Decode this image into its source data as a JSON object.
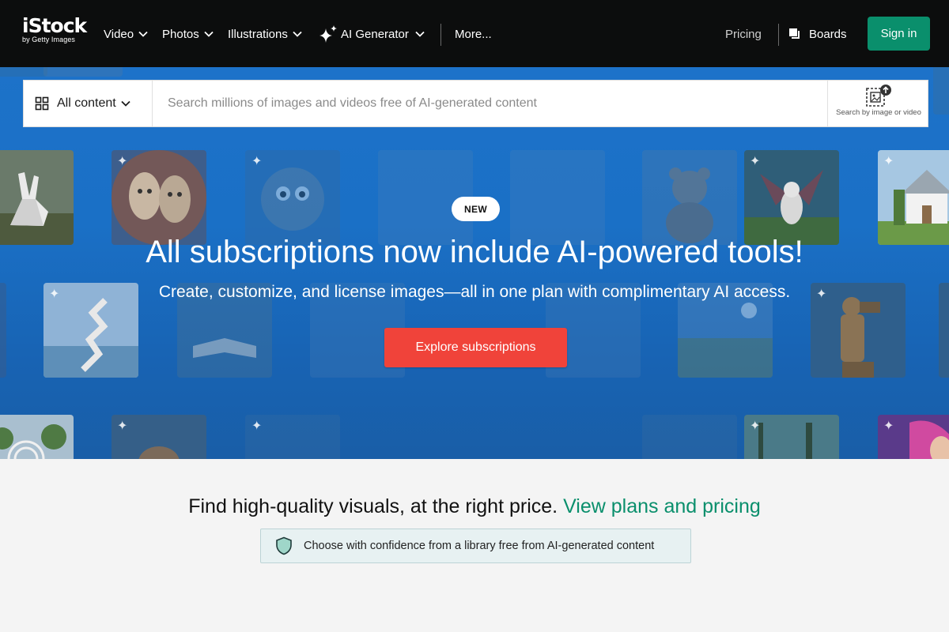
{
  "nav": {
    "logo_main": "iStock",
    "logo_sub": "by Getty Images",
    "items": [
      {
        "label": "Video",
        "icon": "chevron-down-icon"
      },
      {
        "label": "Photos",
        "icon": "chevron-down-icon"
      },
      {
        "label": "Illustrations",
        "icon": "chevron-down-icon"
      },
      {
        "label": "AI Generator",
        "icon": "sparkle-icon"
      },
      {
        "label": "More..."
      }
    ],
    "pricing": "Pricing",
    "boards": "Boards",
    "signin": "Sign in"
  },
  "search": {
    "scope": "All content",
    "placeholder": "Search millions of images and videos free of AI-generated content",
    "by_image_label": "Search by image or video"
  },
  "hero": {
    "badge": "NEW",
    "title": "All subscriptions now include AI-powered tools!",
    "subtitle": "Create, customize, and license images—all in one plan with complimentary AI access.",
    "cta": "Explore subscriptions",
    "tiles": [
      "rabbit",
      "masks",
      "fluffy-creature",
      "teddy-bear",
      "winged-cat",
      "house",
      "staircase",
      "open-book",
      "landscape",
      "photographer-statue",
      "forest-circle",
      "squirrel",
      "trees",
      "woman-portrait"
    ]
  },
  "lower": {
    "heading": "Find high-quality visuals, at the right price.",
    "link": "View plans and pricing",
    "confidence": "Choose with confidence from a library free from AI-generated content"
  },
  "colors": {
    "nav_bg": "#0c0d0d",
    "signin_bg": "#0a8f6c",
    "hero_blue": "#1d72c9",
    "cta_red": "#f0433a",
    "link_green": "#0a8f6c"
  }
}
